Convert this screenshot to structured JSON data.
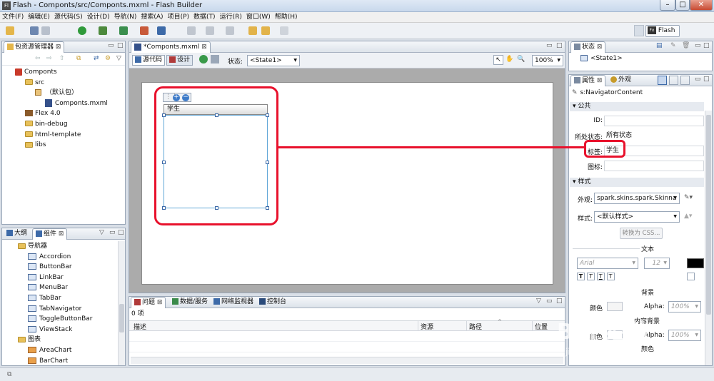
{
  "window": {
    "app_icon": "Fl",
    "title": "Flash - Componts/src/Componts.mxml - Flash Builder",
    "controls": [
      "–",
      "□",
      "✕"
    ]
  },
  "menu": [
    "文件(F)",
    "编辑(E)",
    "源代码(S)",
    "设计(D)",
    "导航(N)",
    "搜索(A)",
    "项目(P)",
    "数据(T)",
    "运行(R)",
    "窗口(W)",
    "帮助(H)"
  ],
  "perspective": {
    "label": "Flash",
    "icon_text": "Fx"
  },
  "package_explorer": {
    "tab": "包资源管理器",
    "tree": [
      {
        "label": "Componts",
        "type": "project",
        "level": 0
      },
      {
        "label": "src",
        "type": "folder",
        "level": 1
      },
      {
        "label": "（默认包）",
        "type": "package",
        "level": 2
      },
      {
        "label": "Componts.mxml",
        "type": "file",
        "level": 3
      },
      {
        "label": "Flex 4.0",
        "type": "library",
        "level": 1
      },
      {
        "label": "bin-debug",
        "type": "folder",
        "level": 1
      },
      {
        "label": "html-template",
        "type": "folder",
        "level": 1
      },
      {
        "label": "libs",
        "type": "folder",
        "level": 1
      }
    ]
  },
  "outline_panel": {
    "tabs": [
      "大纲",
      "组件"
    ],
    "groups": [
      {
        "label": "导航器",
        "items": [
          "Accordion",
          "ButtonBar",
          "LinkBar",
          "MenuBar",
          "TabBar",
          "TabNavigator",
          "ToggleButtonBar",
          "ViewStack"
        ]
      },
      {
        "label": "图表",
        "items": [
          "AreaChart",
          "BarChart"
        ]
      }
    ]
  },
  "editor": {
    "tab": "*Componts.mxml",
    "mode_source": "源代码",
    "mode_design": "设计",
    "state_label": "状态:",
    "state_value": "<State1>",
    "zoom": "100%",
    "navigator_tab": "学生"
  },
  "problems": {
    "tabs": [
      "问题",
      "数据/服务",
      "网络监视器",
      "控制台"
    ],
    "count": "0 项",
    "columns": [
      "描述",
      "资源",
      "路径",
      "位置"
    ]
  },
  "states_panel": {
    "tab": "状态",
    "item": "<State1>"
  },
  "properties": {
    "tabs": [
      "属性",
      "外观"
    ],
    "component": "s:NavigatorContent",
    "section_common": "公共",
    "fields": [
      {
        "label": "ID:",
        "value": ""
      },
      {
        "label": "所处状态:",
        "value": "所有状态"
      },
      {
        "label": "标签:",
        "value": "学生"
      },
      {
        "label": "图标:",
        "value": ""
      }
    ],
    "section_style": "样式",
    "skin_label": "外观:",
    "skin_value": "spark.skins.spark.Skinna",
    "style_label": "样式:",
    "style_value": "<默认样式>",
    "convert_css": "转换为 CSS...",
    "text_heading": "文本",
    "font": "Arial",
    "font_size": "12",
    "bg_heading": "背景",
    "color_label": "颜色",
    "alpha_label": "Alpha:",
    "alpha_value": "100%",
    "content_bg_heading": "内容背景",
    "content_color_label": "颜色",
    "content_alpha_label": "Alpha:",
    "content_alpha_value": "100%",
    "color_heading": "颜色"
  },
  "watermark": {
    "brand": "Bai 经验",
    "url": "jingyan.baidu.com"
  },
  "colors": {
    "highlight": "#e8112c",
    "accent": "#3d6aa8"
  }
}
